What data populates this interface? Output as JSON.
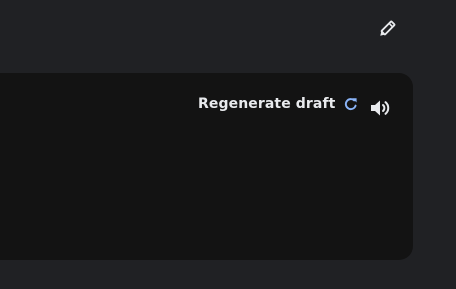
{
  "toolbar": {
    "edit_icon": "pencil-icon"
  },
  "draft": {
    "regenerate_label": "Regenerate draft",
    "regenerate_icon": "refresh-icon",
    "speaker_icon": "volume-icon",
    "text": ""
  },
  "colors": {
    "page_background": "#202124",
    "card_background": "#131313",
    "text": "#e8eaed",
    "accent": "#8ab4f8"
  }
}
